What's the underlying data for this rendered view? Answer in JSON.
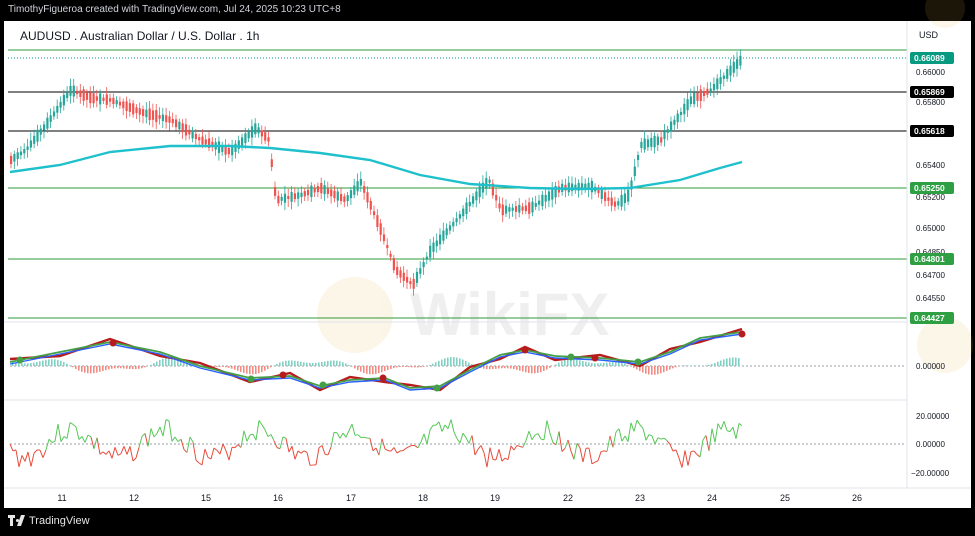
{
  "header": {
    "attribution": "TimothyFigueroa created with TradingView.com, Jul 24, 2025 10:23 UTC+8"
  },
  "chart": {
    "title": "AUDUSD . Australian Dollar / U.S. Dollar . 1h",
    "currency": "USD",
    "price_ticks": [
      "0.66000",
      "0.65800",
      "0.65400",
      "0.65200",
      "0.65000",
      "0.64850",
      "0.64700",
      "0.64550"
    ],
    "level_labels": [
      {
        "text": "0.66089",
        "style": "green"
      },
      {
        "text": "0.65869",
        "style": "black"
      },
      {
        "text": "0.65618",
        "style": "black"
      },
      {
        "text": "0.65250",
        "style": "green"
      },
      {
        "text": "0.64801",
        "style": "green"
      },
      {
        "text": "0.64427",
        "style": "green"
      }
    ],
    "macd_tick": "0.00000",
    "rsi_ticks": [
      "20.00000",
      "0.00000",
      "−20.00000"
    ],
    "date_ticks": [
      "11",
      "12",
      "15",
      "16",
      "17",
      "18",
      "19",
      "22",
      "23",
      "24",
      "25",
      "26"
    ],
    "watermark": "WikiFX",
    "colors": {
      "up": "#26a69a",
      "down": "#ef5350",
      "ma": "#1ec0cc",
      "level_green": "#2e9b3a",
      "accent": "#089981"
    }
  },
  "footer": {
    "brand": "TradingView"
  }
}
